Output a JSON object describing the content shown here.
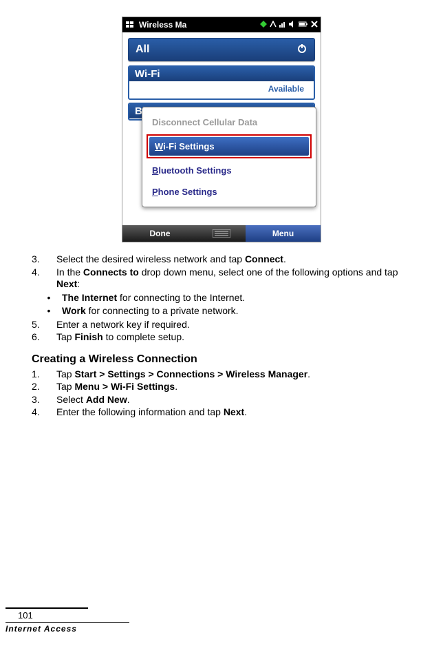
{
  "device": {
    "statusbar_title": "Wireless Ma",
    "all_label": "All",
    "wifi": {
      "label": "Wi-Fi",
      "status": "Available"
    },
    "partial_row_label": "Bl",
    "popup": {
      "disconnect": "Disconnect Cellular Data",
      "wifi_settings_prefix": "W",
      "wifi_settings_rest": "i-Fi Settings",
      "bt_prefix": "B",
      "bt_rest": "luetooth Settings",
      "phone_prefix": "P",
      "phone_rest": "hone Settings"
    },
    "softkeys": {
      "left": "Done",
      "right": "Menu"
    }
  },
  "steps_a": {
    "s3": {
      "num": "3.",
      "t1": "Select the desired wireless network and tap ",
      "b1": "Connect",
      "t2": "."
    },
    "s4": {
      "num": "4.",
      "t1": "In the ",
      "b1": "Connects to",
      "t2": " drop down menu, select one of the following options and tap ",
      "b2": "Next",
      "t3": ":"
    }
  },
  "bullets": {
    "a": {
      "b": "The Internet",
      "t": " for connecting to the Internet."
    },
    "b": {
      "b": "Work",
      "t": " for connecting to a private network."
    }
  },
  "steps_b": {
    "s5": {
      "num": "5.",
      "t": "Enter a network key if required."
    },
    "s6": {
      "num": "6.",
      "t1": "Tap ",
      "b": "Finish",
      "t2": " to complete setup."
    }
  },
  "section_heading": "Creating a Wireless Connection",
  "steps_c": {
    "s1": {
      "num": "1.",
      "t1": "Tap ",
      "b": "Start > Settings > Connections > Wireless Manager",
      "t2": "."
    },
    "s2": {
      "num": "2.",
      "t1": "Tap ",
      "b": "Menu > Wi-Fi Settings",
      "t2": "."
    },
    "s3": {
      "num": "3.",
      "t1": "Select ",
      "b": "Add New",
      "t2": "."
    },
    "s4": {
      "num": "4.",
      "t1": "Enter the following information and tap ",
      "b": "Next",
      "t2": "."
    }
  },
  "footer": {
    "page": "101",
    "label": "Internet Access"
  }
}
